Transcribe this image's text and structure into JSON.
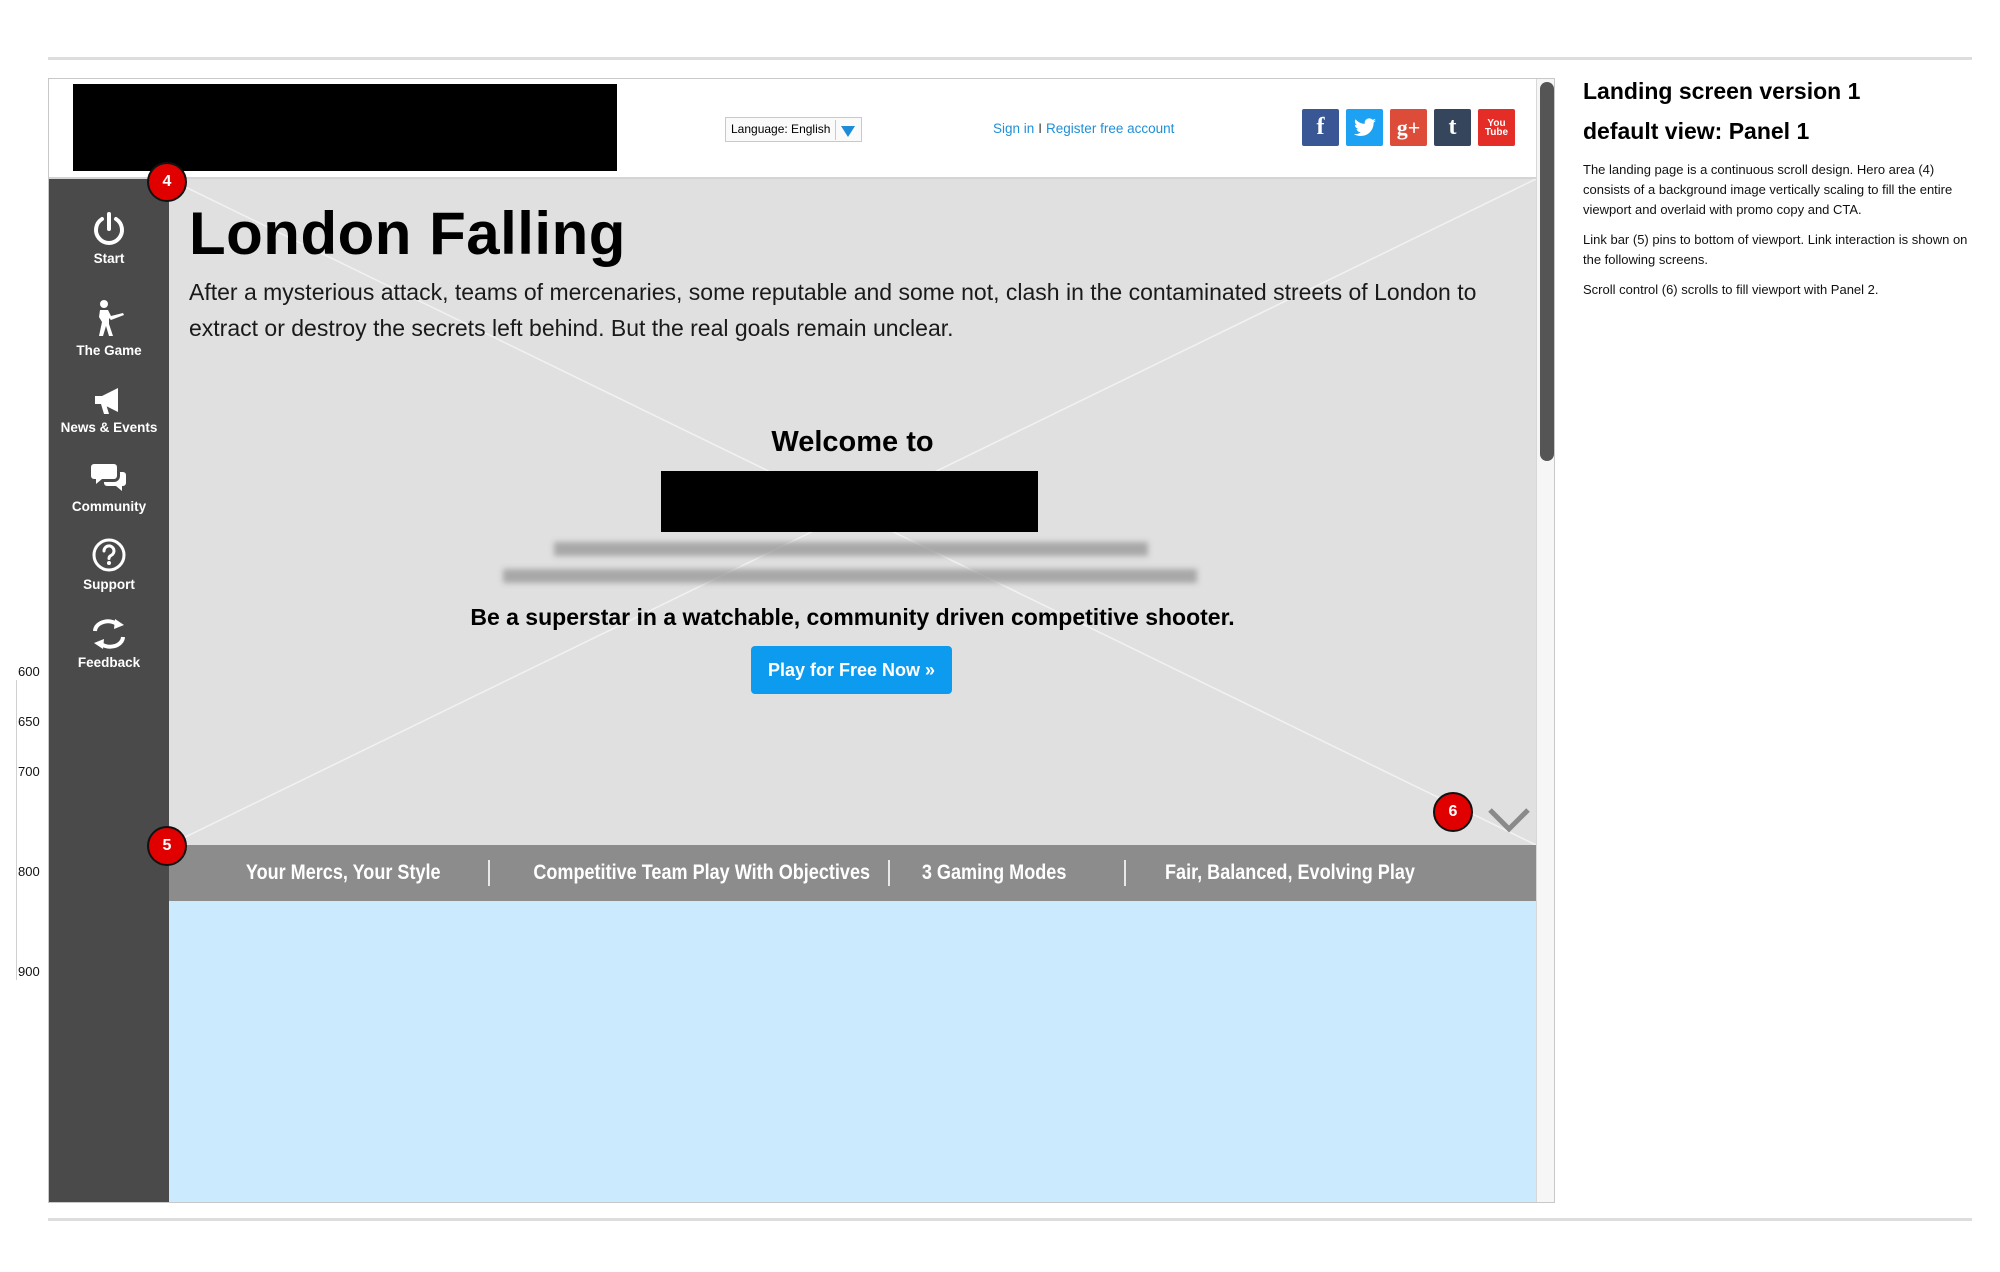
{
  "header": {
    "language_label": "Language: English",
    "sign_in": "Sign in",
    "separator": "I",
    "register": "Register free account",
    "social": [
      {
        "name": "facebook",
        "glyph": "f",
        "color": "#3a5795"
      },
      {
        "name": "twitter",
        "glyph": "🐦",
        "color": "#1da1f2"
      },
      {
        "name": "google-plus",
        "glyph": "g+",
        "color": "#dd4b39"
      },
      {
        "name": "tumblr",
        "glyph": "t",
        "color": "#35465c"
      },
      {
        "name": "youtube",
        "glyph": "You Tube",
        "color": "#e52d27"
      }
    ]
  },
  "sidebar": {
    "items": [
      {
        "label": "Start",
        "icon": "power-icon"
      },
      {
        "label": "The Game",
        "icon": "soldier-icon"
      },
      {
        "label": "News & Events",
        "icon": "megaphone-icon"
      },
      {
        "label": "Community",
        "icon": "chat-bubbles-icon"
      },
      {
        "label": "Support",
        "icon": "question-icon"
      },
      {
        "label": "Feedback",
        "icon": "refresh-arrows-icon"
      }
    ]
  },
  "hero": {
    "title": "London Falling",
    "copy": "After a mysterious attack, teams of mercenaries, some reputable and some not, clash in the contaminated streets of London to extract or destroy the secrets left behind. But the real goals remain unclear.",
    "welcome": "Welcome to",
    "tagline": "Be a superstar in a watchable, community driven competitive shooter.",
    "cta": "Play for Free Now »"
  },
  "linkbar": {
    "links": [
      "Your Mercs, Your Style",
      "Competitive Team Play With Objectives",
      "3 Gaming Modes",
      "Fair, Balanced, Evolving Play"
    ]
  },
  "markers": {
    "hero": "4",
    "linkbar": "5",
    "scroll": "6"
  },
  "ruler": [
    "600",
    "650",
    "700",
    "800",
    "900"
  ],
  "notes": {
    "title": "Landing screen version 1",
    "subtitle": "default view: Panel 1",
    "paragraphs": [
      "The landing page is a continuous scroll design. Hero area (4) consists of a background image vertically scaling to fill the entire viewport and overlaid with promo copy and CTA.",
      "Link bar (5) pins to bottom of viewport. Link interaction is shown on the following screens.",
      "Scroll control (6) scrolls to fill viewport with Panel 2."
    ]
  },
  "colors": {
    "sidebar": "#4a4a4a",
    "hero_bg": "#e0e0e0",
    "cta": "#0d9bf0",
    "linkbar": "#8c8c8c",
    "panel2": "#cbeafd",
    "marker": "#e10000",
    "link": "#1e90d8"
  }
}
